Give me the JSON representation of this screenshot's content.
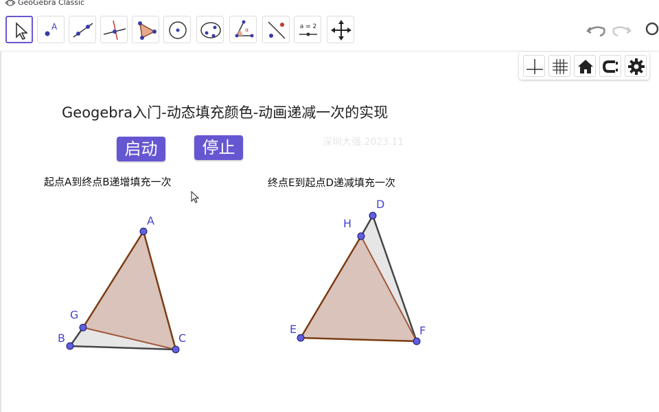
{
  "window": {
    "title": "GeoGebra Classic",
    "minimize_label": "—"
  },
  "toolbar": {
    "tools": [
      {
        "name": "move-tool"
      },
      {
        "name": "point-tool"
      },
      {
        "name": "line-tool"
      },
      {
        "name": "perpendicular-line-tool"
      },
      {
        "name": "polygon-tool"
      },
      {
        "name": "circle-tool"
      },
      {
        "name": "ellipse-tool"
      },
      {
        "name": "angle-tool"
      },
      {
        "name": "reflect-tool"
      },
      {
        "name": "slider-tool",
        "label": "a = 2"
      },
      {
        "name": "move-graphics-view-tool"
      }
    ]
  },
  "page": {
    "title": "Geogebra入门-动态填充颜色-动画递减一次的实现",
    "watermark": "深圳大强.2023.11",
    "start_button": "启动",
    "stop_button": "停止",
    "caption_left": "起点A到终点B递增填充一次",
    "caption_right": "终点E到起点D递减填充一次"
  },
  "points": {
    "left": {
      "A": "A",
      "B": "B",
      "C": "C",
      "G": "G"
    },
    "right": {
      "D": "D",
      "E": "E",
      "F": "F",
      "H": "H"
    }
  },
  "colors": {
    "accent": "#6557d2",
    "point_fill": "#5f5fe0",
    "point_stroke": "#1a1a66",
    "fill_brown": "#d9c3bb",
    "edge_brown": "#7b3b12",
    "fill_gray": "#e6e6e6",
    "edge_gray": "#444444"
  }
}
